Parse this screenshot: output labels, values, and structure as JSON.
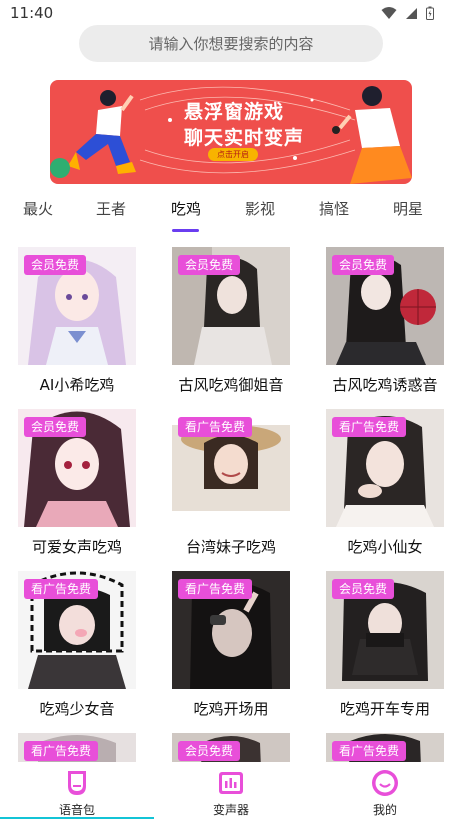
{
  "status_bar": {
    "time": "11:40"
  },
  "search": {
    "placeholder": "请输入你想要搜索的内容"
  },
  "banner": {
    "title_line1": "悬浮窗游戏",
    "title_line2": "聊天实时变声",
    "cta": "点击开启",
    "colors": {
      "bg": "#ef4f4c",
      "cta": "#f8b300"
    }
  },
  "tabs": [
    {
      "label": "最火"
    },
    {
      "label": "王者"
    },
    {
      "label": "吃鸡",
      "active": true
    },
    {
      "label": "影视"
    },
    {
      "label": "搞怪"
    },
    {
      "label": "明星"
    }
  ],
  "cards": [
    {
      "title": "AI小希吃鸡",
      "badge": "会员免费"
    },
    {
      "title": "古风吃鸡御姐音",
      "badge": "会员免费"
    },
    {
      "title": "古风吃鸡诱惑音",
      "badge": "会员免费"
    },
    {
      "title": "可爱女声吃鸡",
      "badge": "会员免费"
    },
    {
      "title": "台湾妹子吃鸡",
      "badge": "看广告免费"
    },
    {
      "title": "吃鸡小仙女",
      "badge": "看广告免费"
    },
    {
      "title": "吃鸡少女音",
      "badge": "看广告免费"
    },
    {
      "title": "吃鸡开场用",
      "badge": "看广告免费"
    },
    {
      "title": "吃鸡开车专用",
      "badge": "会员免费"
    },
    {
      "title": "",
      "badge": "看广告免费"
    },
    {
      "title": "",
      "badge": "会员免费"
    },
    {
      "title": "",
      "badge": "看广告免费"
    }
  ],
  "bottom_nav": [
    {
      "label": "语音包",
      "icon": "voice-pack-icon",
      "active": true
    },
    {
      "label": "变声器",
      "icon": "voice-changer-icon"
    },
    {
      "label": "我的",
      "icon": "profile-icon"
    }
  ],
  "colors": {
    "accent": "#e84fd9",
    "tab_underline": "#6a3df0",
    "nav_active": "#13c4d6"
  }
}
